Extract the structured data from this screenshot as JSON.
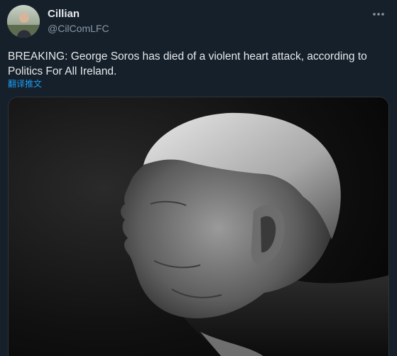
{
  "tweet": {
    "author": {
      "display_name": "Cillian",
      "handle": "@CilComLFC"
    },
    "more_icon": "more-horizontal-icon",
    "text": "BREAKING: George Soros has died of a violent heart attack, according to Politics For All Ireland.",
    "translate_label": "翻译推文",
    "media": {
      "icon": "photo-portrait-image"
    }
  },
  "colors": {
    "background": "#15202b",
    "text": "#e7e9ea",
    "secondary_text": "#8b98a5",
    "link": "#1d9bf0"
  }
}
